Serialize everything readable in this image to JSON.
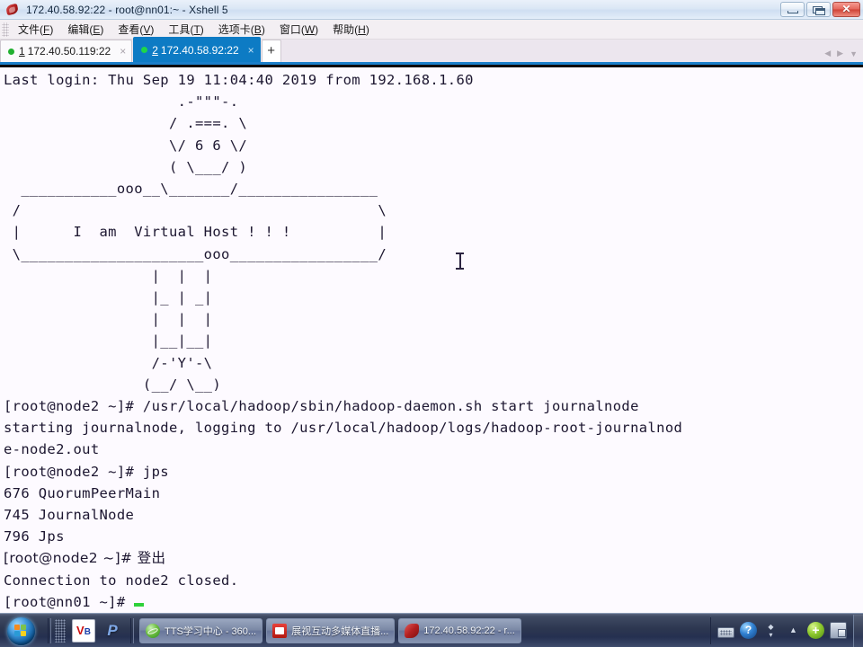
{
  "window": {
    "title": "172.40.58.92:22 - root@nn01:~ - Xshell 5",
    "app_icon": "xshell-icon",
    "controls": {
      "minimize": "minimize-button",
      "restore": "restore-button",
      "close_label": "✕"
    }
  },
  "menubar": {
    "items": [
      {
        "text": "文件",
        "accel": "F"
      },
      {
        "text": "编辑",
        "accel": "E"
      },
      {
        "text": "查看",
        "accel": "V"
      },
      {
        "text": "工具",
        "accel": "T"
      },
      {
        "text": "选项卡",
        "accel": "B"
      },
      {
        "text": "窗口",
        "accel": "W"
      },
      {
        "text": "帮助",
        "accel": "H"
      }
    ]
  },
  "tabs": {
    "items": [
      {
        "num": "1",
        "label": "172.40.50.119:22",
        "active": false,
        "status": "connected",
        "close_label": "×"
      },
      {
        "num": "2",
        "label": "172.40.58.92:22",
        "active": true,
        "status": "connected",
        "close_label": "×"
      }
    ],
    "new_tab_label": "+",
    "nav_prev": "◀",
    "nav_next": "▶",
    "nav_menu": "▼"
  },
  "terminal": {
    "colors": {
      "background": "#fdfaff",
      "foreground": "#1c1630",
      "cursor": "#2fd13a",
      "accent_blue": "#0d7bc4"
    },
    "lines": [
      "Last login: Thu Sep 19 11:04:40 2019 from 192.168.1.60",
      "                    .-\"\"\"-.",
      "                   / .===. \\",
      "                   \\/ 6 6 \\/",
      "                   ( \\___/ )",
      "  ___________ooo__\\_______/________________",
      " /                                         \\",
      " |      I  am  Virtual Host ! ! !          |",
      " \\_____________________ooo_________________/",
      "                 |  |  |",
      "                 |_ | _|",
      "                 |  |  |",
      "                 |__|__|",
      "                 /-'Y'-\\",
      "                (__/ \\__)",
      "",
      "[root@node2 ~]# /usr/local/hadoop/sbin/hadoop-daemon.sh start journalnode",
      "starting journalnode, logging to /usr/local/hadoop/logs/hadoop-root-journalnod",
      "e-node2.out",
      "[root@node2 ~]# jps",
      "676 QuorumPeerMain",
      "745 JournalNode",
      "796 Jps",
      "[root@node2 ~]# 登出",
      "Connection to node2 closed.",
      "[root@nn01 ~]# "
    ],
    "cursor_symbol": "_",
    "mouse_cursor": "i-beam"
  },
  "taskbar": {
    "start_label": "start-orb",
    "quick_launch": [
      {
        "name": "virtualbox-icon",
        "label": "V",
        "sub": "B"
      },
      {
        "name": "pplive-icon",
        "label": "P"
      }
    ],
    "buttons": [
      {
        "icon": "ie-icon",
        "label": "TTS学习中心 - 360..."
      },
      {
        "icon": "tv-icon",
        "label": "展视互动多媒体直播..."
      },
      {
        "icon": "xshell-icon",
        "label": "172.40.58.92:22 - r..."
      }
    ],
    "tray": [
      {
        "name": "keyboard-ime-icon"
      },
      {
        "name": "help-icon",
        "label": "?"
      },
      {
        "name": "tray-overflow-icon",
        "label": "▲"
      },
      {
        "name": "360-safe-icon"
      },
      {
        "name": "network-icon"
      }
    ],
    "show_desktop": "show-desktop-button"
  }
}
